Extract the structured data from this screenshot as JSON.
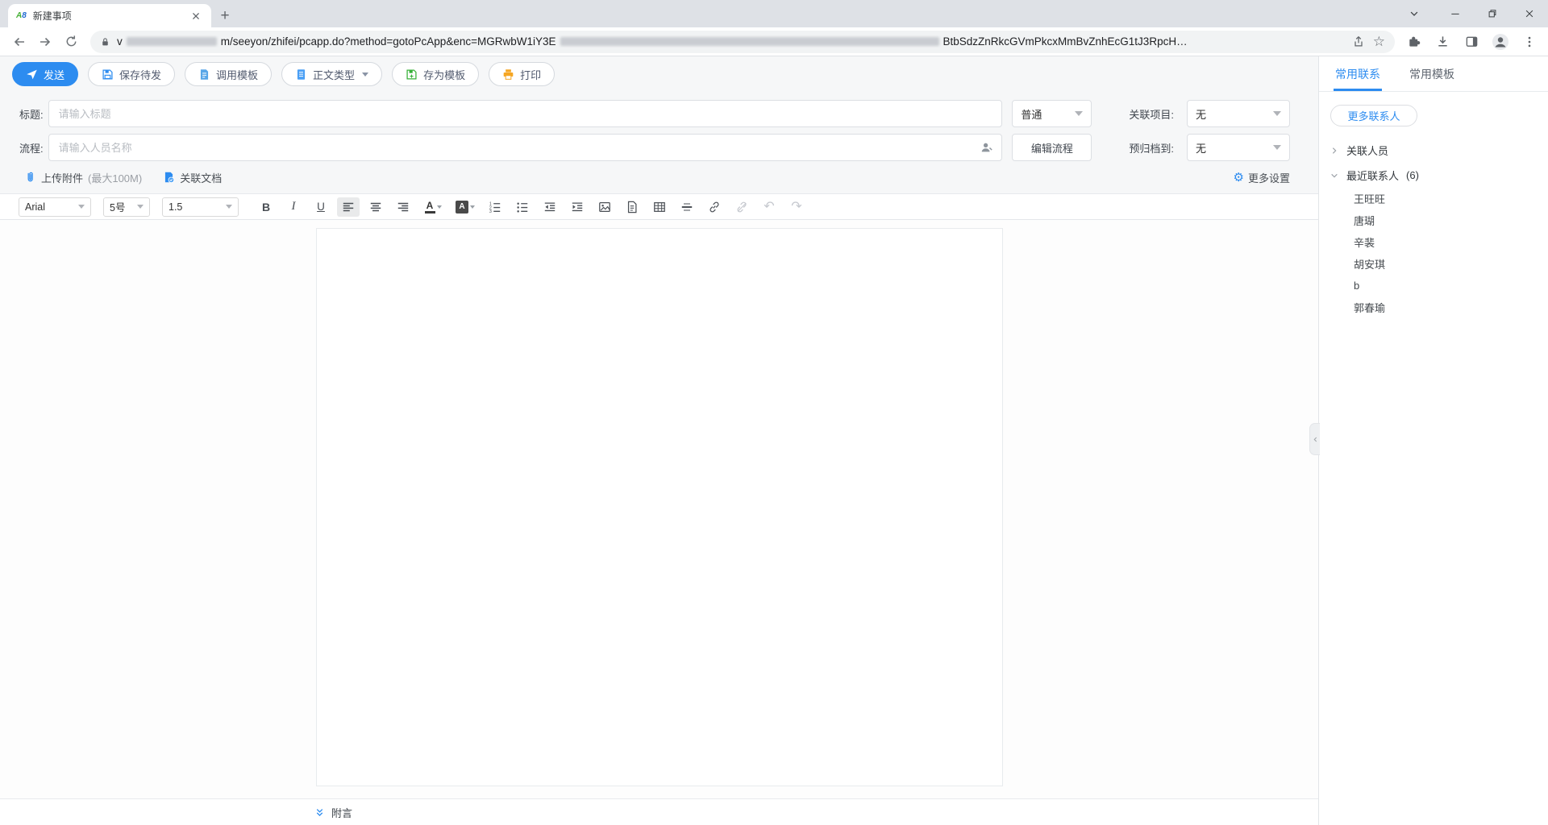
{
  "colors": {
    "accent_blue": "#2d8cf0",
    "save_template_green": "#36b037",
    "print_orange": "#f5a623",
    "chrome_strip": "#dee1e6",
    "url_pill": "#f1f3f4"
  },
  "browser": {
    "tab_title": "新建事项",
    "favicon": {
      "part1": "A",
      "part2": "8"
    },
    "url_prefix": "v",
    "url_part1": "m/seeyon/zhifei/pcapp.do?method=gotoPcApp&enc=MGRwbW1iY3E",
    "url_part2": "BtbSdzZnRkcGVmPkcxMmBvZnhEcG1tJ3RpcH…"
  },
  "action_bar": {
    "send": "发送",
    "save_pending": "保存待发",
    "use_template": "调用模板",
    "body_type": "正文类型",
    "save_as_template": "存为模板",
    "print": "打印"
  },
  "form": {
    "title_label": "标题:",
    "title_placeholder": "请输入标题",
    "priority_value": "普通",
    "related_project_label": "关联项目:",
    "related_project_value": "无",
    "flow_label": "流程:",
    "flow_placeholder": "请输入人员名称",
    "edit_flow_button": "编辑流程",
    "prearchive_label": "预归档到:",
    "prearchive_value": "无",
    "upload_attachment_text": "上传附件",
    "upload_attachment_limit": "(最大100M)",
    "related_document": "关联文档",
    "more_settings": "更多设置"
  },
  "editor": {
    "font_family_value": "Arial",
    "font_size_value": "5号",
    "line_height_value": "1.5",
    "bold": "B",
    "italic": "I",
    "underline": "U",
    "color_letter": "A",
    "bgcolor_letter": "A",
    "postscript_label": "附言"
  },
  "sidebar": {
    "tabs": [
      {
        "label": "常用联系"
      },
      {
        "label": "常用模板"
      }
    ],
    "more_contacts_button": "更多联系人",
    "groups": [
      {
        "label": "关联人员",
        "count": ""
      },
      {
        "label": "最近联系人",
        "count": "(6)"
      }
    ],
    "recent_contacts": [
      "王旺旺",
      "唐瑚",
      "辛裴",
      "胡安琪",
      "b",
      "郭春瑜"
    ]
  }
}
